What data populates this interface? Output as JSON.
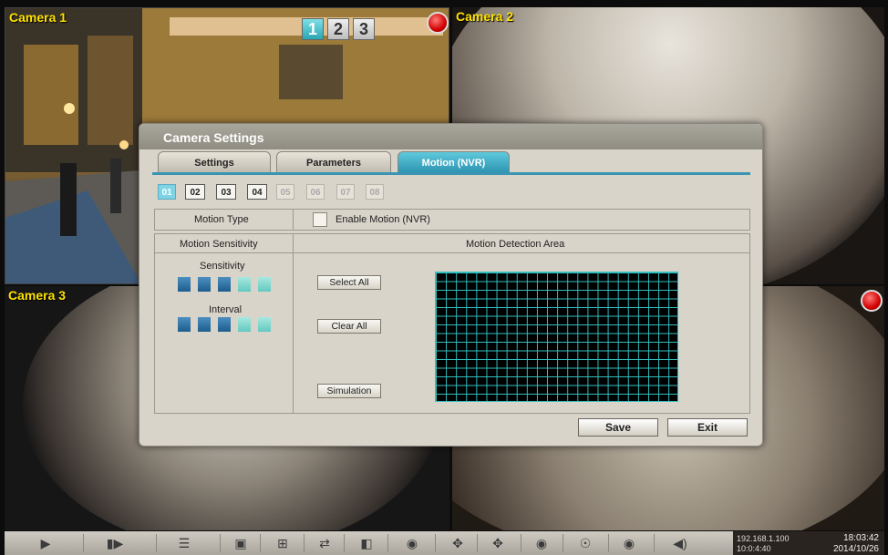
{
  "cameras": [
    {
      "label": "Camera 1"
    },
    {
      "label": "Camera 2"
    },
    {
      "label": "Camera 3"
    }
  ],
  "page_selector": [
    "1",
    "2",
    "3"
  ],
  "dialog": {
    "title": "Camera Settings",
    "tabs": [
      {
        "label": "Settings"
      },
      {
        "label": "Parameters"
      },
      {
        "label": "Motion (NVR)",
        "active": true
      }
    ],
    "channels": [
      {
        "label": "01",
        "state": "active"
      },
      {
        "label": "02",
        "state": "enabled"
      },
      {
        "label": "03",
        "state": "enabled"
      },
      {
        "label": "04",
        "state": "enabled"
      },
      {
        "label": "05",
        "state": "disabled"
      },
      {
        "label": "06",
        "state": "disabled"
      },
      {
        "label": "07",
        "state": "disabled"
      },
      {
        "label": "08",
        "state": "disabled"
      }
    ],
    "motion_type_label": "Motion Type",
    "enable_motion_label": "Enable Motion (NVR)",
    "enable_motion_checked": false,
    "motion_sensitivity_header": "Motion Sensitivity",
    "motion_detection_area_header": "Motion Detection Area",
    "sensitivity_label": "Sensitivity",
    "sensitivity_level": 3,
    "sensitivity_max": 5,
    "interval_label": "Interval",
    "interval_level": 3,
    "interval_max": 5,
    "select_all_label": "Select All",
    "clear_all_label": "Clear All",
    "simulation_label": "Simulation",
    "grid_columns": 24,
    "grid_rows": 15,
    "save_label": "Save",
    "exit_label": "Exit"
  },
  "status": {
    "ip": "192.168.1.100",
    "uptime": "10:0:4:40",
    "time": "18:03:42",
    "date": "2014/10/26"
  },
  "colors": {
    "accent": "#2b93b0",
    "camera_label": "#ffe200",
    "grid": "#33bfbf"
  }
}
